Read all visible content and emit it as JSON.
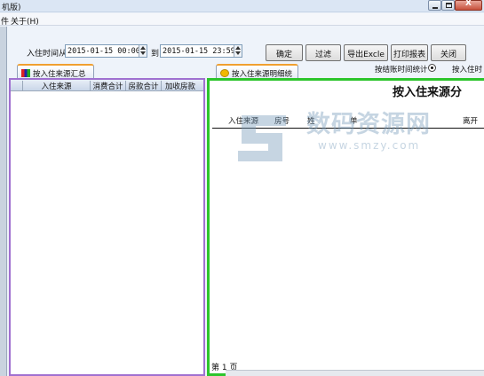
{
  "window": {
    "title": "机版)",
    "close_glyph": "X"
  },
  "menu": {
    "items": [
      "件",
      "关于(H)"
    ]
  },
  "toolbar": {
    "from_label": "入住时间从",
    "from_value": "2015-01-15 00:00",
    "to_label": "到",
    "to_value": "2015-01-15 23:59",
    "buttons": {
      "confirm": "确定",
      "filter": "过滤",
      "export": "导出Excle",
      "print": "打印报表",
      "close": "关闭"
    },
    "radio_checkout_label": "按结账时间统计",
    "radio_checkin_label": "按入住时"
  },
  "left_tab": {
    "label": "按入住来源汇总",
    "icon": "chart-icon",
    "columns": [
      "入住来源",
      "消费合计",
      "房款合计",
      "加收房款"
    ]
  },
  "right_tab": {
    "label": "按入住来源明细统计",
    "icon": "coin-icon",
    "report_title": "按入住来源分",
    "columns": [
      "入住来源",
      "房号",
      "姓",
      "单",
      "",
      "离开"
    ],
    "page_label": "第 1 页"
  },
  "watermark": {
    "text": "数码资源网",
    "url": "www.smzy.com"
  },
  "colors": {
    "left_panel_border": "#a070d0",
    "right_panel_border": "#2cc52c",
    "tab_accent": "#f0a030"
  }
}
